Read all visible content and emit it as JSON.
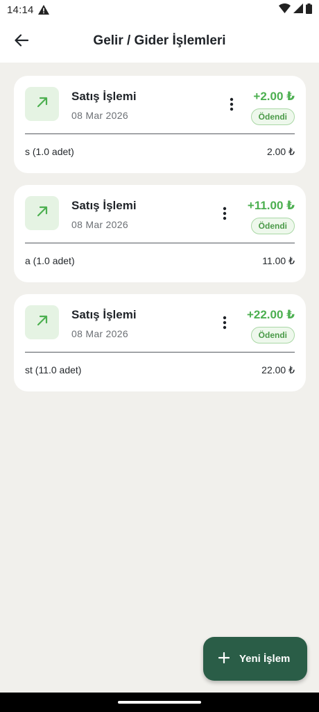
{
  "status_bar": {
    "time": "14:14"
  },
  "app_bar": {
    "title": "Gelir / Gider İşlemleri"
  },
  "transactions": [
    {
      "title": "Satış İşlemi",
      "date": "08 Mar 2026",
      "amount": "+2.00 ₺",
      "status": "Ödendi",
      "line_desc": "s (1.0 adet)",
      "line_amount": "2.00 ₺"
    },
    {
      "title": "Satış İşlemi",
      "date": "08 Mar 2026",
      "amount": "+11.00 ₺",
      "status": "Ödendi",
      "line_desc": "a (1.0 adet)",
      "line_amount": "11.00 ₺"
    },
    {
      "title": "Satış İşlemi",
      "date": "08 Mar 2026",
      "amount": "+22.00 ₺",
      "status": "Ödendi",
      "line_desc": "st (11.0 adet)",
      "line_amount": "22.00 ₺"
    }
  ],
  "fab": {
    "label": "Yeni İşlem"
  },
  "colors": {
    "income_green": "#4caf50",
    "fab_background": "#2a5d47",
    "badge_border": "#a9d7a5",
    "icon_box_bg": "#e5f3e3",
    "page_background": "#f1f0ec"
  },
  "icons": {
    "back": "arrow-left-icon",
    "income": "arrow-up-right-icon",
    "menu": "more-vertical-icon",
    "add": "plus-icon",
    "alert": "warning-icon",
    "wifi": "wifi-icon",
    "signal": "signal-icon",
    "battery": "battery-icon"
  }
}
